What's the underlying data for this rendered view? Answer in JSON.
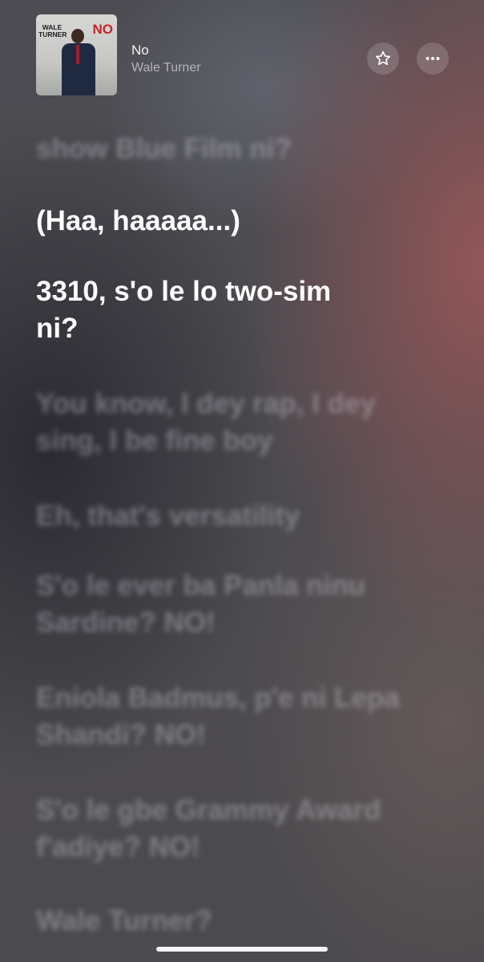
{
  "now_playing": {
    "title": "No",
    "artist": "Wale Turner",
    "artwork": {
      "artist_text": "WALE TURNER",
      "title_text": "NO",
      "accent_color": "#c8232a"
    }
  },
  "controls": {
    "favorite_icon": "star-icon",
    "more_icon": "ellipsis-icon"
  },
  "lyrics": {
    "lines": [
      {
        "text": "show Blue Film ni?",
        "active": false
      },
      {
        "text": "(Haa, haaaaa...)",
        "active": true
      },
      {
        "text": "3310, s'o le lo two-sim ni?",
        "active": true
      },
      {
        "text": "You know, I dey rap, I dey sing, I be fine boy",
        "active": false
      },
      {
        "text": "Eh, that's versatility",
        "active": false
      },
      {
        "text": "S'o le ever ba Panla ninu Sardine? NO!",
        "active": false
      },
      {
        "text": "Eniola Badmus, p'e ni Lepa Shandi? NO!",
        "active": false
      },
      {
        "text": "S'o le gbe Grammy Award f'adiye? NO!",
        "active": false
      },
      {
        "text": "Wale Turner?",
        "active": false
      }
    ]
  },
  "colors": {
    "active_lyric": "#ffffff",
    "background": "#4a4a4e"
  }
}
